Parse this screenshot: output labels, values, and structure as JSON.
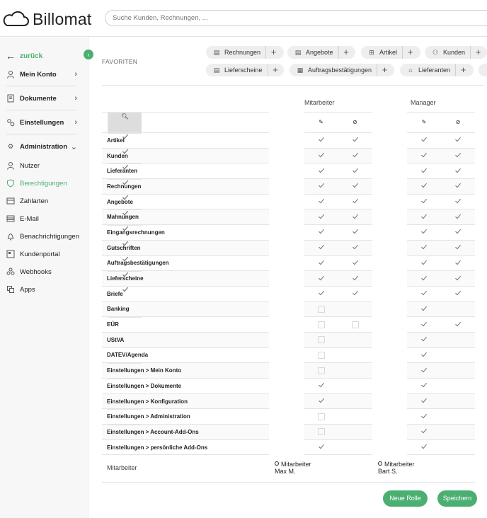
{
  "app": {
    "brand": "Billomat"
  },
  "search": {
    "placeholder": "Suche Kunden, Rechnungen, ..."
  },
  "sidebar": {
    "back_label": "zurück",
    "collapse_icon": "chevron-left-icon",
    "items": [
      {
        "label": "Mein Konto",
        "icon": "user-icon",
        "chevron": true
      },
      {
        "label": "Dokumente",
        "icon": "document-icon",
        "chevron": true
      },
      {
        "label": "Einstellungen",
        "icon": "settings-icon",
        "chevron": true
      },
      {
        "label": "Administration",
        "icon": "gear-icon",
        "chevron": true,
        "expanded": true
      },
      {
        "label": "Nutzer",
        "icon": "user-icon"
      },
      {
        "label": "Berechtigungen",
        "icon": "shield-icon",
        "active": true
      },
      {
        "label": "Zahlarten",
        "icon": "payment-icon"
      },
      {
        "label": "E-Mail",
        "icon": "mail-icon"
      },
      {
        "label": "Benachrichtigungen",
        "icon": "bell-icon"
      },
      {
        "label": "Kundenportal",
        "icon": "portal-icon"
      },
      {
        "label": "Webhooks",
        "icon": "webhook-icon"
      },
      {
        "label": "Apps",
        "icon": "apps-icon"
      }
    ]
  },
  "favorites": {
    "label": "FAVORITEN",
    "row1": [
      "Rechnungen",
      "Angebote",
      "Artikel",
      "Kunden"
    ],
    "row2": [
      "Lieferscheine",
      "Auftragsbestätigungen",
      "Lieferanten"
    ]
  },
  "permissions": {
    "groups": [
      "Mitarbeiter",
      "Manager"
    ],
    "header_icons": [
      "view-icon",
      "edit-icon",
      "delete-icon"
    ],
    "rows": [
      {
        "label": "Artikel",
        "m": [
          "c",
          "c",
          "c"
        ],
        "g": [
          "c",
          "c",
          "c"
        ]
      },
      {
        "label": "Kunden",
        "m": [
          "c",
          "c",
          "c"
        ],
        "g": [
          "c",
          "c",
          "c"
        ]
      },
      {
        "label": "Lieferanten",
        "m": [
          "c",
          "c",
          "c"
        ],
        "g": [
          "c",
          "c",
          "c"
        ]
      },
      {
        "label": "Rechnungen",
        "m": [
          "c",
          "c",
          "c"
        ],
        "g": [
          "c",
          "c",
          "c"
        ]
      },
      {
        "label": "Angebote",
        "m": [
          "c",
          "c",
          "c"
        ],
        "g": [
          "c",
          "c",
          "c"
        ]
      },
      {
        "label": "Mahnungen",
        "m": [
          "c",
          "c",
          "c"
        ],
        "g": [
          "c",
          "c",
          "c"
        ]
      },
      {
        "label": "Eingangsrechnungen",
        "m": [
          "c",
          "c",
          "c"
        ],
        "g": [
          "c",
          "c",
          "c"
        ]
      },
      {
        "label": "Gutschriften",
        "m": [
          "c",
          "c",
          "c"
        ],
        "g": [
          "c",
          "c",
          "c"
        ]
      },
      {
        "label": "Auftragsbestätigungen",
        "m": [
          "c",
          "c",
          "c"
        ],
        "g": [
          "c",
          "c",
          "c"
        ]
      },
      {
        "label": "Lieferscheine",
        "m": [
          "c",
          "c",
          "c"
        ],
        "g": [
          "c",
          "c",
          "c"
        ]
      },
      {
        "label": "Briefe",
        "m": [
          "c",
          "c",
          "c"
        ],
        "g": [
          "c",
          "c",
          "c"
        ]
      },
      {
        "label": "Banking",
        "m": [
          "",
          "b",
          ""
        ],
        "g": [
          "",
          "c",
          ""
        ]
      },
      {
        "label": "EÜR",
        "m": [
          "",
          "b",
          "b"
        ],
        "g": [
          "",
          "c",
          "c"
        ]
      },
      {
        "label": "UStVA",
        "m": [
          "",
          "b",
          ""
        ],
        "g": [
          "",
          "c",
          ""
        ]
      },
      {
        "label": "DATEV/Agenda",
        "m": [
          "",
          "b",
          ""
        ],
        "g": [
          "",
          "c",
          ""
        ]
      },
      {
        "label": "Einstellungen > Mein Konto",
        "m": [
          "",
          "b",
          ""
        ],
        "g": [
          "",
          "c",
          ""
        ]
      },
      {
        "label": "Einstellungen > Dokumente",
        "m": [
          "",
          "c",
          ""
        ],
        "g": [
          "",
          "c",
          ""
        ]
      },
      {
        "label": "Einstellungen > Konfiguration",
        "m": [
          "",
          "c",
          ""
        ],
        "g": [
          "",
          "c",
          ""
        ]
      },
      {
        "label": "Einstellungen > Administration",
        "m": [
          "",
          "b",
          ""
        ],
        "g": [
          "",
          "c",
          ""
        ]
      },
      {
        "label": "Einstellungen > Account-Add-Ons",
        "m": [
          "",
          "b",
          ""
        ],
        "g": [
          "",
          "c",
          ""
        ]
      },
      {
        "label": "Einstellungen > persönliche Add-Ons",
        "m": [
          "",
          "c",
          ""
        ],
        "g": [
          "",
          "c",
          ""
        ]
      }
    ]
  },
  "footer": {
    "label": "Mitarbeiter",
    "employees": [
      {
        "role": "Mitarbeiter",
        "name": "Max M."
      },
      {
        "role": "Mitarbeiter",
        "name": "Bart S."
      }
    ]
  },
  "actions": {
    "new_role": "Neue Rolle",
    "save": "Speichern"
  },
  "colors": {
    "accent": "#4caf72"
  }
}
